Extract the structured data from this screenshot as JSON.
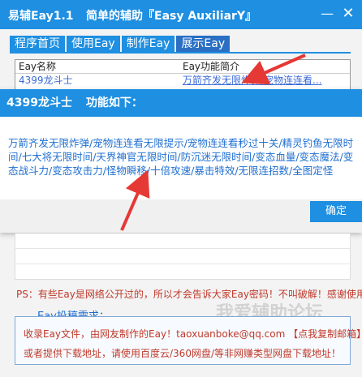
{
  "window": {
    "title": "易辅Eay1.1",
    "subtitle": "简单的辅助『Easy AuxiliarY』",
    "minimize_label": "—",
    "close_label": "✕"
  },
  "tabs": [
    {
      "label": "程序首页"
    },
    {
      "label": "使用Eay"
    },
    {
      "label": "制作Eay"
    },
    {
      "label": "展示Eay",
      "active": true
    }
  ],
  "list": {
    "headers": [
      "Eay名称",
      "Eay功能简介"
    ],
    "rows": [
      {
        "name": "4399龙斗士",
        "desc": "万箭齐发无限炸弹/宠物连连看..."
      }
    ]
  },
  "dialog": {
    "title_name": "4399龙斗士",
    "title_suffix": "功能如下：",
    "body": "万箭齐发无限炸弹/宠物连连看无限提示/宠物连连看秒过十关/精灵钓鱼无限时间/七大将无限时间/天界神官无限时间/防沉迷无限时间/变态血量/变态魔法/变态战斗力/变态攻击力/怪物瞬移/十倍攻速/暴击特效/无限连招数/全图定怪",
    "ok_label": "确定"
  },
  "footer": {
    "ps": "PS：有些Eay是网络公开过的，所以才会告诉大家Eay密码！不叫破解！感谢使用！",
    "contrib_title": "Eay投稿需求：",
    "line1": "收录Eay文件，由网友制作的Eay！taoxuanboke@qq.com 【点我复制邮箱】",
    "line2": "或者提供下载地址，请使用百度云/360网盘/等非网赚类型网盘下载地址！",
    "watermark": "我爱辅助论坛"
  },
  "colors": {
    "accent": "#1e8fe1",
    "link_text": "#1f6fd0",
    "warning_text": "#c0392b",
    "arrow": "#e53935"
  }
}
